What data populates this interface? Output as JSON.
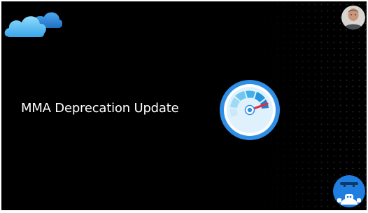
{
  "slide": {
    "title": "MMA Deprecation Update"
  },
  "icons": {
    "logo": "azure-cloud-icon",
    "avatar": "presenter-avatar",
    "gauge": "speedometer-icon",
    "corner": "robot-mascot-icon"
  },
  "colors": {
    "background": "#000000",
    "title_text": "#ffffff",
    "gauge_ring": "#2f8fe6",
    "gauge_needle": "#e5323a",
    "cloud_light": "#5ec3f0",
    "cloud_dark": "#2a86d8"
  }
}
